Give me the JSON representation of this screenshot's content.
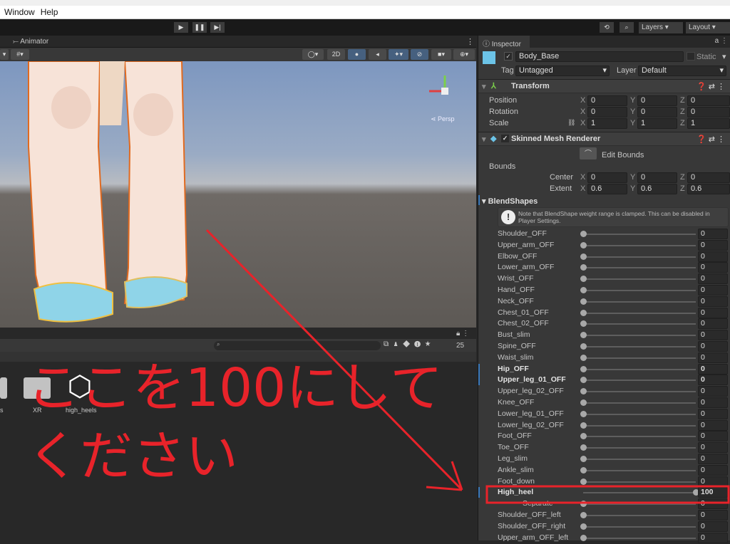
{
  "menu": [
    "Window",
    "Help"
  ],
  "toolbar": {
    "play": "▶",
    "pause": "❚❚",
    "step": "▶|",
    "layers": "Layers",
    "layout": "Layout"
  },
  "scene": {
    "tab_label": "Animator",
    "btn_2d": "2D",
    "persp": "Persp"
  },
  "project": {
    "search_placeholder": "",
    "hidden_count": "25",
    "items": [
      {
        "label": "s"
      },
      {
        "label": "XR"
      },
      {
        "label": "high_heels"
      }
    ]
  },
  "inspector": {
    "tab": "Inspector",
    "object_name": "Body_Base",
    "static_label": "Static",
    "tag_label": "Tag",
    "tag_value": "Untagged",
    "layer_label": "Layer",
    "layer_value": "Default",
    "transform": {
      "title": "Transform",
      "rows": [
        {
          "label": "Position",
          "x": "0",
          "y": "0",
          "z": "0"
        },
        {
          "label": "Rotation",
          "x": "0",
          "y": "0",
          "z": "0"
        },
        {
          "label": "Scale",
          "x": "1",
          "y": "1",
          "z": "1"
        }
      ]
    },
    "smr": {
      "title": "Skinned Mesh Renderer",
      "edit_bounds": "Edit Bounds",
      "bounds": "Bounds",
      "center": {
        "label": "Center",
        "x": "0",
        "y": "0",
        "z": "0"
      },
      "extent": {
        "label": "Extent",
        "x": "0.6",
        "y": "0.6",
        "z": "0.6"
      }
    },
    "axis": {
      "x": "X",
      "y": "Y",
      "z": "Z"
    },
    "blendshapes": {
      "title": "BlendShapes",
      "note": "Note that BlendShape weight range is clamped. This can be disabled in Player Settings.",
      "items": [
        {
          "name": "Shoulder_OFF",
          "value": 0
        },
        {
          "name": "Upper_arm_OFF",
          "value": 0
        },
        {
          "name": "Elbow_OFF",
          "value": 0
        },
        {
          "name": "Lower_arm_OFF",
          "value": 0
        },
        {
          "name": "Wrist_OFF",
          "value": 0
        },
        {
          "name": "Hand_OFF",
          "value": 0
        },
        {
          "name": "Neck_OFF",
          "value": 0
        },
        {
          "name": "Chest_01_OFF",
          "value": 0
        },
        {
          "name": "Chest_02_OFF",
          "value": 0
        },
        {
          "name": "Bust_slim",
          "value": 0
        },
        {
          "name": "Spine_OFF",
          "value": 0
        },
        {
          "name": "Waist_slim",
          "value": 0
        },
        {
          "name": "Hip_OFF",
          "value": 0,
          "bold": true
        },
        {
          "name": "Upper_leg_01_OFF",
          "value": 0,
          "bold": true
        },
        {
          "name": "Upper_leg_02_OFF",
          "value": 0
        },
        {
          "name": "Knee_OFF",
          "value": 0
        },
        {
          "name": "Lower_leg_01_OFF",
          "value": 0
        },
        {
          "name": "Lower_leg_02_OFF",
          "value": 0
        },
        {
          "name": "Foot_OFF",
          "value": 0
        },
        {
          "name": "Toe_OFF",
          "value": 0
        },
        {
          "name": "Leg_slim",
          "value": 0
        },
        {
          "name": "Ankle_slim",
          "value": 0
        },
        {
          "name": "Foot_down",
          "value": 0
        },
        {
          "name": "High_heel",
          "value": 100,
          "bold": true
        },
        {
          "name": "----------Separate------",
          "value": 0
        },
        {
          "name": "Shoulder_OFF_left",
          "value": 0
        },
        {
          "name": "Shoulder_OFF_right",
          "value": 0
        },
        {
          "name": "Upper_arm_OFF_left",
          "value": 0
        }
      ]
    }
  },
  "annotation": {
    "line1": "ここを100にして",
    "line2": "ください",
    "color": "#e8232a"
  }
}
